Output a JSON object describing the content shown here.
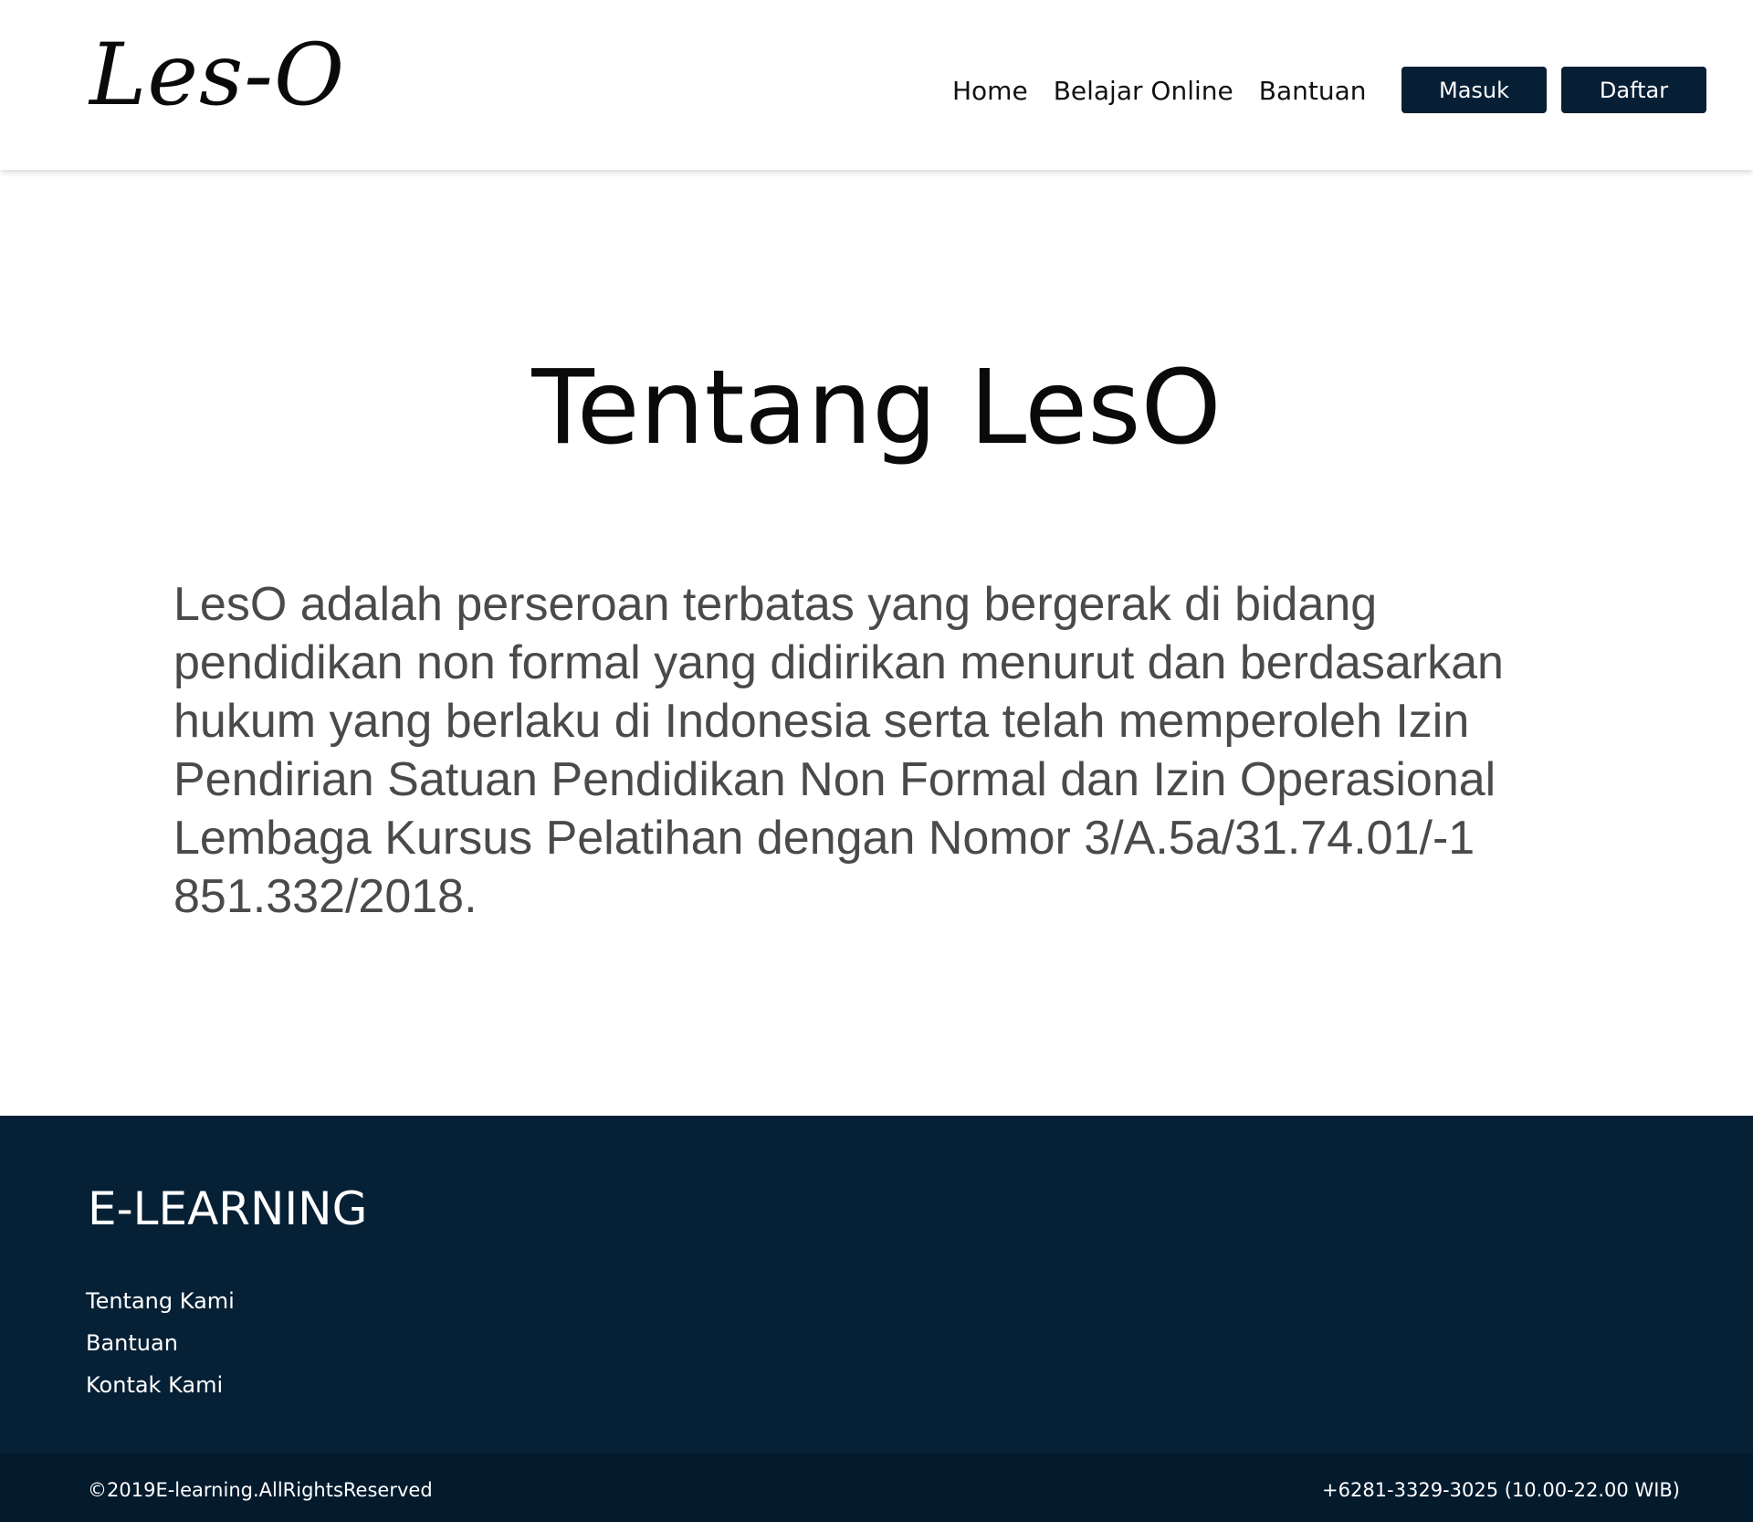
{
  "header": {
    "logo": "Les-O",
    "nav": [
      {
        "label": "Home"
      },
      {
        "label": "Belajar Online"
      },
      {
        "label": "Bantuan"
      }
    ],
    "login_label": "Masuk",
    "register_label": "Daftar"
  },
  "main": {
    "title": "Tentang LesO",
    "body": "LesO adalah perseroan terbatas yang bergerak di bidang pendidikan non formal yang didirikan menurut dan berdasarkan hukum yang berlaku di Indonesia serta telah memperoleh Izin Pendirian Satuan Pendidikan Non Formal dan Izin Operasional Lembaga Kursus Pelatihan dengan Nomor 3/A.5a/31.74.01/-1 851.332/2018."
  },
  "footer": {
    "brand": "E-LEARNING",
    "links": [
      {
        "label": "Tentang Kami"
      },
      {
        "label": "Bantuan"
      },
      {
        "label": "Kontak Kami"
      }
    ],
    "copyright": "©2019E-learning.AllRightsReserved",
    "contact": "+6281-3329-3025 (10.00-22.00 WIB)"
  },
  "colors": {
    "navy": "#062035",
    "button": "#061f35",
    "body_text": "#4a4a4a"
  }
}
